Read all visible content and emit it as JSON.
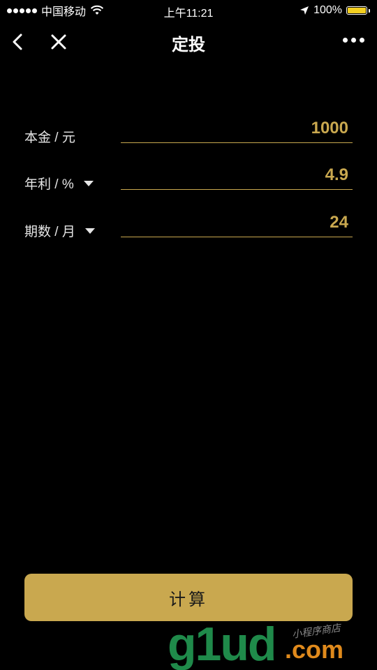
{
  "status_bar": {
    "carrier": "中国移动",
    "time": "上午11:21",
    "battery": "100%",
    "battery_color": "#f4d020",
    "icons": [
      "signal-dots-icon",
      "wifi-icon",
      "location-arrow-icon",
      "battery-icon"
    ]
  },
  "nav": {
    "title": "定投",
    "back_icon": "chevron-left-icon",
    "close_icon": "close-icon",
    "more_icon": "more-dots-icon"
  },
  "form": {
    "principal": {
      "label": "本金 / 元",
      "value": "1000"
    },
    "rate": {
      "label": "年利 / %",
      "value": "4.9",
      "dropdown_icon": "caret-down-icon"
    },
    "period": {
      "label": "期数 / 月",
      "value": "24",
      "dropdown_icon": "caret-down-icon"
    }
  },
  "calc_button": {
    "label": "计算"
  },
  "watermark": {
    "main": "g1ud",
    "suffix": ".com",
    "sub": "小程序商店"
  },
  "colors": {
    "background": "#000000",
    "accent": "#c9a84f",
    "label": "#e6e6e6",
    "button_text": "#1a1a1a"
  }
}
